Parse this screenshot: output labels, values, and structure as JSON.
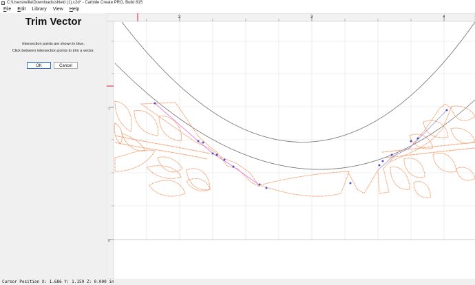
{
  "window": {
    "title": "C:\\Users\\willa\\Downloads\\shield (1).c2d* - Carbide Create PRO, Build 815"
  },
  "menu": [
    {
      "key": "F",
      "rest": "ile"
    },
    {
      "key": "E",
      "rest": "dit"
    },
    {
      "key": "",
      "rest": "Library"
    },
    {
      "key": "",
      "rest": "View"
    },
    {
      "key": "H",
      "rest": "elp"
    }
  ],
  "panel": {
    "title": "Trim Vector",
    "line1": "Intersection points are shown in blue.",
    "line2": "Click between intersection points to trim a vector.",
    "ok_label": "OK",
    "cancel_label": "Cancel"
  },
  "ruler": {
    "top_labels": [
      "2",
      "3",
      "4"
    ],
    "left_labels": [
      "1",
      "0"
    ]
  },
  "colors": {
    "vector_orange": "#f0a070",
    "guide_line": "#707070",
    "selected_vector": "#e080e0",
    "intersection": "#5050c0",
    "ruler_marker": "#d02020"
  },
  "status": {
    "cursor_text": "Cursor Position X: 1.686 Y: 1.159 Z: 0.000 in"
  }
}
